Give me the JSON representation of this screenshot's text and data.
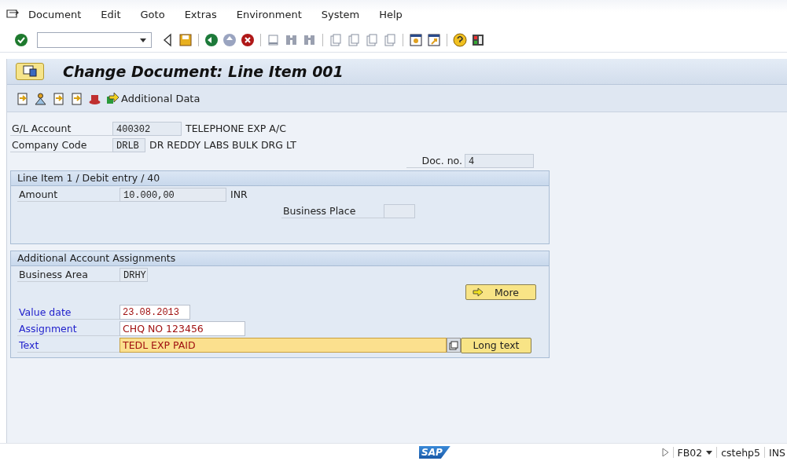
{
  "menu": [
    "Document",
    "Edit",
    "Goto",
    "Extras",
    "Environment",
    "System",
    "Help"
  ],
  "title": "Change Document: Line Item 001",
  "app_toolbar": {
    "button": "Additional Data"
  },
  "header_fields": [
    {
      "label": "G/L Account",
      "value": "400302",
      "description": "TELEPHONE EXP A/C"
    },
    {
      "label": "Company Code",
      "value": "DRLB",
      "description": "DR REDDY LABS BULK DRG LT"
    }
  ],
  "doc_no": {
    "label": "Doc. no.",
    "value": "4"
  },
  "line_item_group": {
    "title": "Line Item 1 / Debit entry / 40",
    "amount": {
      "label": "Amount",
      "value": "10.000,00",
      "unit": "INR"
    },
    "business_place": {
      "label": "Business Place"
    }
  },
  "assignment_group": {
    "title": "Additional Account Assignments",
    "business_area": {
      "label": "Business Area",
      "value": "DRHY"
    },
    "more_button": "More",
    "fields": [
      {
        "label": "Value date",
        "value": "23.08.2013",
        "focused": false
      },
      {
        "label": "Assignment",
        "value": "CHQ NO 123456",
        "focused": false
      },
      {
        "label": "Text",
        "value": "TEDL EXP PAID",
        "focused": true
      }
    ],
    "long_text_button": "Long text"
  },
  "status_bar": {
    "logo": "SAP",
    "transaction": "FB02",
    "server": "cstehp5",
    "mode": "INS"
  }
}
